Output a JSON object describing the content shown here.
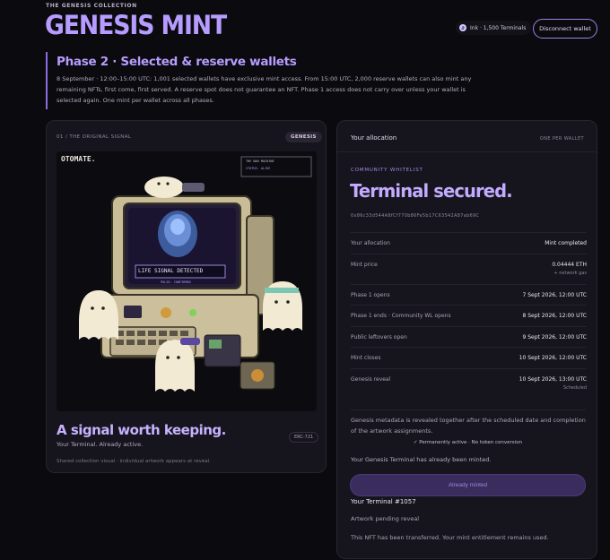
{
  "header": {
    "eyebrow": "THE GENESIS COLLECTION",
    "title": "GENESIS MINT",
    "network": "Ink · 1,500 Terminals",
    "network_icon": "ink-logo-icon",
    "disconnect_label": "Disconnect wallet"
  },
  "phase": {
    "title": "Phase 2 · Selected & reserve wallets",
    "description": "8 September · 12:00–15:00 UTC: 1,001 selected wallets have exclusive mint access. From 15:00 UTC, 2,000 reserve wallets can also mint any remaining NFTs, first come, first served. A reserve spot does not guarantee an NFT. Phase 1 access does not carry over unless your wallet is selected again. One mint per wallet across all phases."
  },
  "art_card": {
    "eyebrow": "01 / THE ORIGINAL SIGNAL",
    "badge": "GENESIS",
    "artwork": {
      "corner_text": "OTOMATE.",
      "panel_title": "THE NAH MACHINE",
      "panel_status": "STATUS: ALIVE",
      "screen_text": "LIFE SIGNAL DETECTED",
      "screen_subtext": "PULSE: CONFIRMED"
    },
    "heading": "A signal worth keeping.",
    "standard": "ERC-721",
    "subtitle": "Your Terminal. Already active.",
    "note": "Shared collection visual · individual artwork appears at reveal."
  },
  "allocation": {
    "title": "Your allocation",
    "tag": "ONE PER WALLET",
    "eyebrow": "COMMUNITY WHITELIST",
    "headline": "Terminal secured.",
    "address": "0x86c33d544A8fCf770b86Fe5b17C63542A87ab69C",
    "rows": [
      {
        "label": "Your allocation",
        "value": "Mint completed",
        "sub": ""
      },
      {
        "label": "Mint price",
        "value": "0.04444 ETH",
        "sub": "+ network gas"
      },
      {
        "label": "Phase 1 opens",
        "value": "7 Sept 2026, 12:00 UTC",
        "sub": ""
      },
      {
        "label": "Phase 1 ends · Community WL opens",
        "value": "8 Sept 2026, 12:00 UTC",
        "sub": ""
      },
      {
        "label": "Public leftovers open",
        "value": "9 Sept 2026, 12:00 UTC",
        "sub": ""
      },
      {
        "label": "Mint closes",
        "value": "10 Sept 2026, 12:00 UTC",
        "sub": ""
      },
      {
        "label": "Genesis reveal",
        "value": "10 Sept 2026, 13:00 UTC",
        "sub": "Scheduled"
      }
    ],
    "reveal_note": "Genesis metadata is revealed together after the scheduled date and completion of the artwork assignments.",
    "checks": "✓ Permanently active · No token conversion",
    "minted_note": "Your Genesis Terminal has already been minted.",
    "button_label": "Already minted",
    "terminal_id": "Your Terminal #1057",
    "artwork_status": "Artwork pending reveal",
    "transfer_note": "This NFT has been transferred. Your mint entitlement remains used."
  }
}
